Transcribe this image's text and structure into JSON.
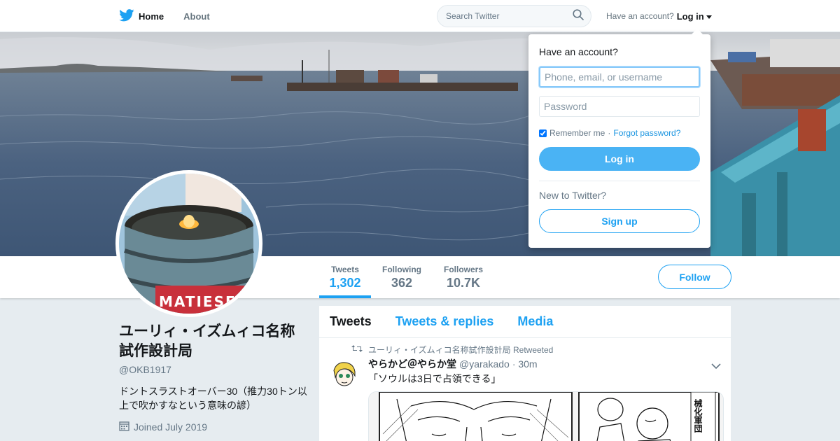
{
  "nav": {
    "home_label": "Home",
    "about_label": "About",
    "home_icon": "twitter-bird-icon",
    "brand_color": "#1da1f2"
  },
  "search": {
    "placeholder": "Search Twitter",
    "icon": "search-icon"
  },
  "account": {
    "question": "Have an account?",
    "login_label": "Log in"
  },
  "login_dropdown": {
    "title": "Have an account?",
    "username_placeholder": "Phone, email, or username",
    "password_placeholder": "Password",
    "remember_label": "Remember me",
    "remember_checked": true,
    "separator": "·",
    "forgot_label": "Forgot password?",
    "login_button": "Log in",
    "new_label": "New to Twitter?",
    "signup_button": "Sign up"
  },
  "profile": {
    "name": "ユーリィ・イズムィコ名称試作設計局",
    "handle": "@OKB1917",
    "bio": "ドントスラストオーバー30（推力30トン以上で吹かすなという意味の諺）",
    "joined": "Joined July 2019",
    "avatar_text": "MATIESEN",
    "follow_label": "Follow"
  },
  "stats": [
    {
      "label": "Tweets",
      "value": "1,302",
      "active": true
    },
    {
      "label": "Following",
      "value": "362",
      "active": false
    },
    {
      "label": "Followers",
      "value": "10.7K",
      "active": false
    }
  ],
  "timeline": {
    "tabs": [
      {
        "label": "Tweets",
        "active": true
      },
      {
        "label": "Tweets & replies",
        "active": false
      },
      {
        "label": "Media",
        "active": false
      }
    ],
    "tweet": {
      "retweet_text": "ユーリィ・イズムィコ名称試作設計局 Retweeted",
      "author_name": "やらかど＠やらか堂",
      "author_handle": "@yarakado",
      "time": "· 30m",
      "text": "「ソウルは3日で占領できる」",
      "media_caption": "械化軍団"
    }
  }
}
